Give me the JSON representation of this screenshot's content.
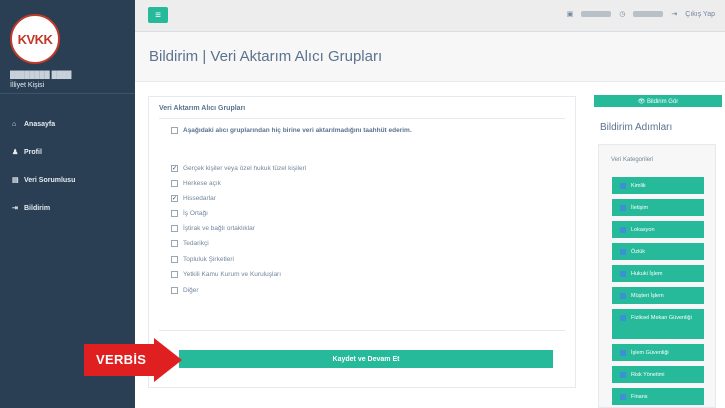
{
  "sidebar": {
    "logo_text": "KVKK",
    "user_name": "████████ ████",
    "user_role": "İlliyet Kişisi",
    "items": [
      {
        "icon": "home-icon",
        "glyph": "⌂",
        "label": "Anasayfa"
      },
      {
        "icon": "user-icon",
        "glyph": "♟",
        "label": "Profil"
      },
      {
        "icon": "book-icon",
        "glyph": "▤",
        "label": "Veri Sorumlusu"
      },
      {
        "icon": "signin-icon",
        "glyph": "⇥",
        "label": "Bildirim"
      }
    ]
  },
  "topbar": {
    "menu_glyph": "≡",
    "logout_label": "Çıkış Yap"
  },
  "page": {
    "title": "Bildirim | Veri Aktarım Alıcı Grupları"
  },
  "panel": {
    "title": "Veri Aktarım Alıcı Grupları",
    "declaration": "Aşağıdaki alıcı gruplarından hiç birine veri aktarılmadığını taahhüt ederim.",
    "options": [
      {
        "label": "Gerçek kişiler veya özel hukuk tüzel kişileri",
        "checked": true
      },
      {
        "label": "Herkese açık",
        "checked": false
      },
      {
        "label": "Hissedarlar",
        "checked": true
      },
      {
        "label": "İş Ortağı",
        "checked": false
      },
      {
        "label": "İştirak ve bağlı ortaklıklar",
        "checked": false
      },
      {
        "label": "Tedarikçi",
        "checked": false
      },
      {
        "label": "Topluluk Şirketleri",
        "checked": false
      },
      {
        "label": "Yetkili Kamu Kurum ve Kuruluşları",
        "checked": false
      },
      {
        "label": "Diğer",
        "checked": false
      }
    ],
    "save_label": "Kaydet ve Devam Et"
  },
  "badge": {
    "text": "VERBİS",
    "color": "#e02020"
  },
  "right": {
    "notify_label": "👁 Bildirim Gör",
    "steps_title": "Bildirim Adımları",
    "categories_title": "Veri Kategorileri",
    "steps": [
      "Kimlik",
      "İletişim",
      "Lokasyon",
      "Özlük",
      "Hukuki İşlem",
      "Müşteri İşlem",
      "Fiziksel Mekan Güvenliği",
      "İşlem Güvenliği",
      "Risk Yönetimi",
      "Finans"
    ]
  },
  "colors": {
    "accent": "#26b99a",
    "sidebar": "#2a3f54"
  }
}
